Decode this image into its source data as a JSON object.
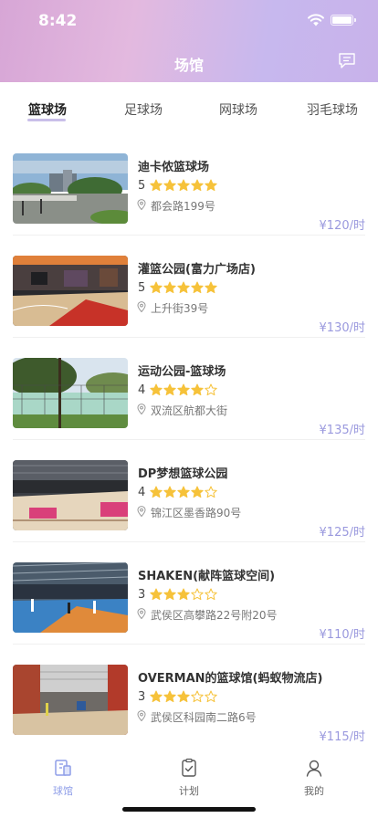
{
  "status_bar": {
    "time": "8:42"
  },
  "header": {
    "title": "场馆"
  },
  "tabs": [
    {
      "label": "篮球场",
      "active": true
    },
    {
      "label": "足球场",
      "active": false
    },
    {
      "label": "网球场",
      "active": false
    },
    {
      "label": "羽毛球场",
      "active": false
    }
  ],
  "venues": [
    {
      "name": "迪卡侬篮球场",
      "score": "5",
      "rating": 5,
      "address": "都会路199号",
      "price": "¥120/时"
    },
    {
      "name": "灌篮公园(富力广场店)",
      "score": "5",
      "rating": 5,
      "address": "上升街39号",
      "price": "¥130/时"
    },
    {
      "name": "运动公园-篮球场",
      "score": "4",
      "rating": 4,
      "address": "双流区航都大街",
      "price": "¥135/时"
    },
    {
      "name": "DP梦想篮球公园",
      "score": "4",
      "rating": 4,
      "address": "锦江区墨香路90号",
      "price": "¥125/时"
    },
    {
      "name": "SHAKEN(献阵篮球空间)",
      "score": "3",
      "rating": 3,
      "address": "武侯区高攀路22号附20号",
      "price": "¥110/时"
    },
    {
      "name": "OVERMAN的篮球馆(蚂蚁物流店)",
      "score": "3",
      "rating": 3,
      "address": "武侯区科园南二路6号",
      "price": "¥115/时"
    }
  ],
  "tabbar": [
    {
      "label": "球馆",
      "icon": "venue-icon",
      "active": true
    },
    {
      "label": "计划",
      "icon": "clipboard-check-icon",
      "active": false
    },
    {
      "label": "我的",
      "icon": "person-icon",
      "active": false
    }
  ],
  "colors": {
    "star": "#f6c23a",
    "star_empty": "#f6c23a",
    "accent": "#9a99de",
    "tab_active": "#8f9ee8"
  }
}
